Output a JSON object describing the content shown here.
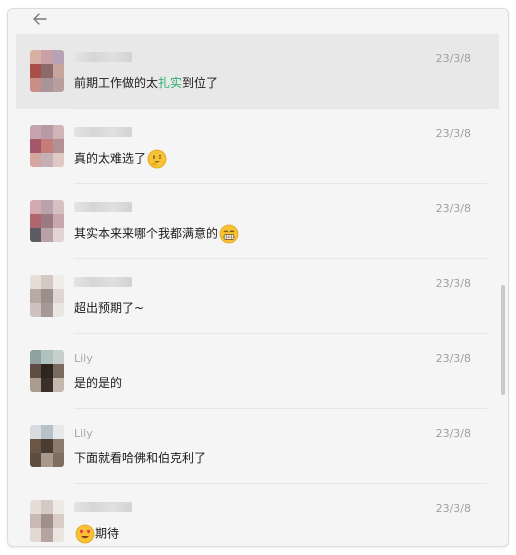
{
  "header": {
    "back_icon": "arrow-left-icon"
  },
  "conversations": [
    {
      "name": "",
      "time": "23/3/8",
      "message_parts": [
        "前期工作做的太",
        "扎实",
        "到位了"
      ],
      "highlighted": true,
      "avatar_palette": [
        "#d8b0a4",
        "#c7a1a6",
        "#b7a2b6",
        "#a84f47",
        "#8c6a6c",
        "#c8a59a",
        "#c98e86",
        "#a9949b",
        "#b99ea0"
      ]
    },
    {
      "name": "",
      "time": "23/3/8",
      "message": "真的太难选了",
      "emoji": "thinking-emoji-icon",
      "avatar_palette": [
        "#c7a4ad",
        "#b79aa5",
        "#d2b4b7",
        "#a5576a",
        "#c77d77",
        "#b39096",
        "#d3a6a2",
        "#c5b0b5",
        "#e0c8c4"
      ]
    },
    {
      "name": "",
      "time": "23/3/8",
      "message": "其实本来来哪个我都满意的",
      "emoji": "grinning-emoji-icon",
      "avatar_palette": [
        "#d3aab0",
        "#b9a3aa",
        "#d5c0c2",
        "#b1666e",
        "#9a7b84",
        "#c8a8ad",
        "#5c5a62",
        "#b8a0a6",
        "#e3d3d3"
      ]
    },
    {
      "name": "",
      "time": "23/3/8",
      "message": "超出预期了~",
      "avatar_palette": [
        "#e6ddd8",
        "#d5c8c2",
        "#f0ece8",
        "#b7aaa3",
        "#9c8f8b",
        "#e0d6d1",
        "#cfc2bc",
        "#a69896",
        "#ece6e2"
      ]
    },
    {
      "name": "Lily",
      "time": "23/3/8",
      "message": "是的是的",
      "avatar_palette": [
        "#8fa2a0",
        "#b0c2bd",
        "#c7d0cc",
        "#5f4c42",
        "#2e2520",
        "#7a6a60",
        "#a89b8f",
        "#3a302b",
        "#c5b8ae"
      ]
    },
    {
      "name": "Lily",
      "time": "23/3/8",
      "message": "下面就看哈佛和伯克利了",
      "avatar_palette": [
        "#d8dce0",
        "#b9c1c8",
        "#e6e8ea",
        "#6b5646",
        "#4a3c33",
        "#8b7b6e",
        "#5d4c40",
        "#a7998e",
        "#7e6e62"
      ]
    },
    {
      "name": "",
      "time": "23/3/8",
      "message": "期待",
      "emoji_before": "heart-eyes-emoji-icon",
      "avatar_palette": [
        "#e6ddd8",
        "#d6c9c4",
        "#efe9e5",
        "#c7b9b4",
        "#a08f8b",
        "#d9ccc7",
        "#e3d8d3",
        "#b5a4a0",
        "#ece4e0"
      ]
    }
  ],
  "colors": {
    "highlight_green": "#2aae67",
    "timestamp": "#a0a0a0",
    "selected_row": "#e8e8e8"
  }
}
